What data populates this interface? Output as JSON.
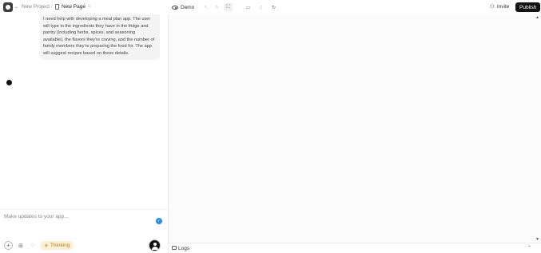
{
  "header": {
    "project": "New Project",
    "separator": "/",
    "page": "New Page",
    "page_extra": "⌂",
    "demo_label": "Demo",
    "invite_label": "Invite",
    "publish_label": "Publish"
  },
  "chat": {
    "message": "I need help with developing a meal plan app. The user will type in the ingredients they have in the fridge and pantry (including herbs, spices, and seasoning available), the flavors they're craving, and the number of family members they're preparing the food for. The app will suggest recipes based on these details.",
    "input_placeholder": "Make updates to your app...",
    "thinking_label": "Thinking"
  },
  "preview": {
    "logs_label": "Logs"
  },
  "colors": {
    "publish_bg": "#111111",
    "thinking_bg": "#fdf0d8",
    "thinking_text": "#c07a10",
    "check_badge": "#2b8de8"
  }
}
